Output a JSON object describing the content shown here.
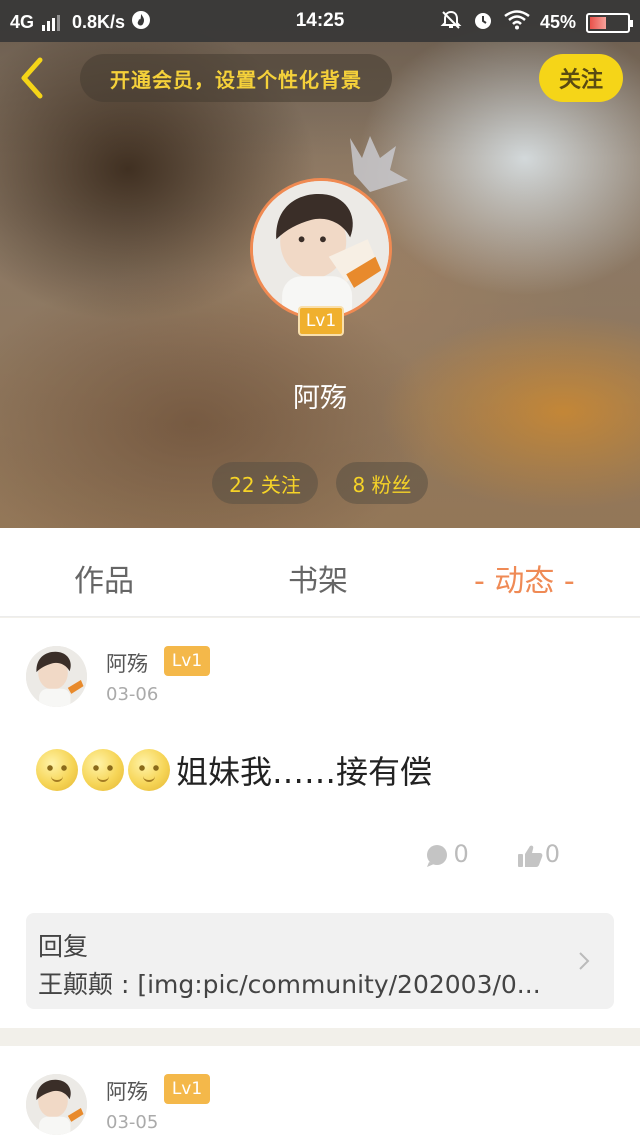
{
  "status_bar": {
    "network": "4G",
    "speed": "0.8K/s",
    "time": "14:25",
    "battery": "45%",
    "battery_level": 0.45
  },
  "topbar": {
    "vip_banner": "开通会员，设置个性化背景",
    "follow_label": "关注"
  },
  "profile": {
    "name": "阿殇",
    "level": "Lv1",
    "following": "22 关注",
    "fans": "8 粉丝"
  },
  "tabs": [
    {
      "label": "作品"
    },
    {
      "label": "书架"
    },
    {
      "label": "- 动态 -",
      "active": true
    }
  ],
  "feed": [
    {
      "user": "阿殇",
      "level": "Lv1",
      "date": "03-06",
      "text": "姐妹我……接有偿",
      "emoji_count": 3,
      "comments": "0",
      "likes": "0",
      "reply": {
        "title": "回复",
        "text": "王颠颠 : [img:pic/community/202003/0..."
      }
    },
    {
      "user": "阿殇",
      "level": "Lv1",
      "date": "03-05"
    }
  ],
  "colors": {
    "accent_orange": "#ef8a55",
    "follow_yellow": "#f5d518",
    "level_badge": "#f4b84a",
    "stat_text": "#f6d327"
  }
}
